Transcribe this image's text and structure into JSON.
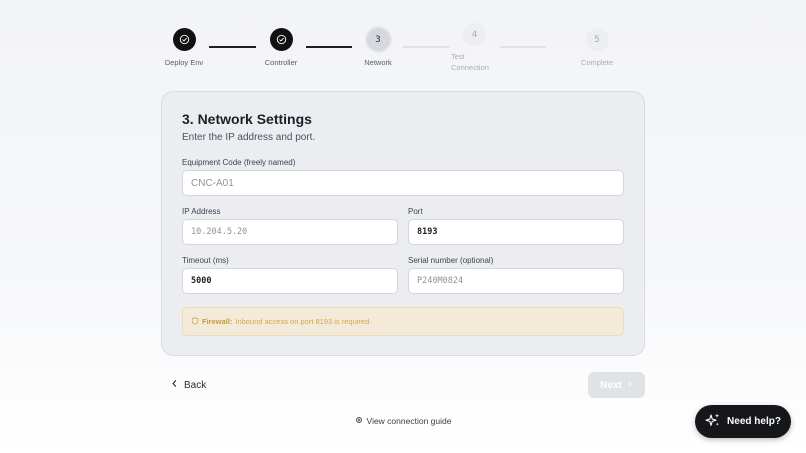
{
  "stepper": {
    "steps": [
      {
        "number": "",
        "label": "Deploy Env",
        "state": "done"
      },
      {
        "number": "",
        "label": "Controller",
        "state": "done"
      },
      {
        "number": "3",
        "label": "Network",
        "state": "current"
      },
      {
        "number": "4",
        "label": "Test Connection",
        "state": "future"
      },
      {
        "number": "5",
        "label": "Complete",
        "state": "future"
      }
    ]
  },
  "card": {
    "title": "3. Network Settings",
    "subtitle": "Enter the IP address and port.",
    "fields": {
      "equipment_code": {
        "label": "Equipment Code (freely named)",
        "placeholder": "CNC-A01",
        "value": ""
      },
      "ip_address": {
        "label": "IP Address",
        "placeholder": "10.204.5.20",
        "value": ""
      },
      "port": {
        "label": "Port",
        "placeholder": "",
        "value": "8193"
      },
      "timeout": {
        "label": "Timeout (ms)",
        "placeholder": "",
        "value": "5000"
      },
      "serial_number": {
        "label": "Serial number (optional)",
        "placeholder": "P240M0824",
        "value": ""
      }
    },
    "notice": {
      "title": "Firewall:",
      "text": "Inbound access on port 8193 is required."
    }
  },
  "nav": {
    "back_label": "Back",
    "next_label": "Next"
  },
  "footer": {
    "guide_link": "View connection guide"
  },
  "help": {
    "label": "Need help?"
  },
  "colors": {
    "accent_dark": "#111111",
    "warning_bg": "#f4ead9",
    "warning_text": "#d2a64e"
  }
}
